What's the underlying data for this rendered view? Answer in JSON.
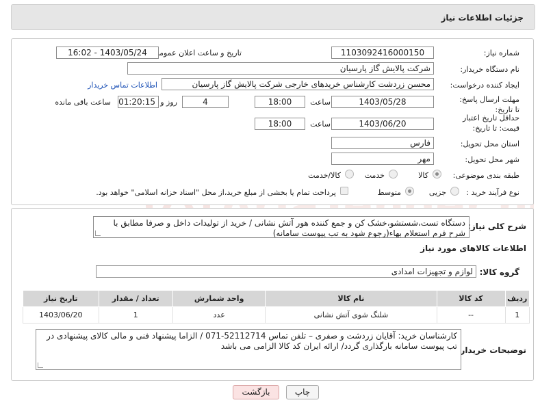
{
  "header": {
    "title": "جزئیات اطلاعات نیاز"
  },
  "fields": {
    "need_number_label": "شماره نیاز:",
    "need_number": "1103092416000150",
    "announce_label": "تاریخ و ساعت اعلان عمومی:",
    "announce_value": "1403/05/24 - 16:02",
    "buyer_org_label": "نام دستگاه خریدار:",
    "buyer_org": "شرکت پالایش گاز پارسیان",
    "requester_label": "ایجاد کننده درخواست:",
    "requester": "محسن زردشت کارشناس خریدهای خارجی شرکت پالایش گاز پارسیان",
    "buyer_contact_link": "اطلاعات تماس خریدار",
    "reply_deadline_label": "مهلت ارسال پاسخ: تا تاریخ:",
    "reply_date": "1403/05/28",
    "time_label": "ساعت",
    "reply_time": "18:00",
    "days_value": "4",
    "days_label": "روز و",
    "remaining_time": "01:20:15",
    "remaining_label": "ساعت باقی مانده",
    "price_validity_label": "حداقل تاریخ اعتبار قیمت: تا تاریخ:",
    "price_date": "1403/06/20",
    "price_time": "18:00",
    "province_label": "استان محل تحویل:",
    "province": "فارس",
    "city_label": "شهر محل تحویل:",
    "city": "مهر",
    "category_label": "طبقه بندی موضوعی:",
    "category_options": [
      "کالا",
      "خدمت",
      "کالا/خدمت"
    ],
    "process_label": "نوع فرآیند خرید :",
    "process_options": [
      "جزیی",
      "متوسط"
    ],
    "payment_note": "پرداخت تمام یا بخشی از مبلغ خرید،از محل \"اسناد خزانه اسلامی\" خواهد بود."
  },
  "description": {
    "label": "شرح کلی نیاز:",
    "text": "دستگاه تست،شستشو،خشک کن و جمع کننده هور آتش نشانی / خرید از تولیدات داخل و صرفا مطابق با شرح فرم استعلام بهاء(رجوع شود به تب پیوست سامانه)"
  },
  "goods_info": {
    "title": "اطلاعات کالاهای مورد نیاز",
    "group_label": "گروه کالا:",
    "group_value": "لوازم و تجهیزات امدادی"
  },
  "table": {
    "headers": [
      "ردیف",
      "کد کالا",
      "نام کالا",
      "واحد شمارش",
      "تعداد / مقدار",
      "تاریخ نیاز"
    ],
    "rows": [
      [
        "1",
        "--",
        "شلنگ شوی آتش نشانی",
        "عدد",
        "1",
        "1403/06/20"
      ]
    ]
  },
  "buyer_notes": {
    "label": "توضیحات خریدار:",
    "text": "کارشناسان خرید: آقایان زردشت و صفری – تلفن تماس 52112714-071 / الزاما پیشنهاد فنی و مالی کالای پیشنهادی در تب پیوست سامانه بارگذاری گردد/ ارائه ایران کد کالا الزامی می باشد"
  },
  "buttons": {
    "print": "چاپ",
    "back": "بازگشت"
  },
  "watermark": {
    "text": "AriaTender.net"
  }
}
